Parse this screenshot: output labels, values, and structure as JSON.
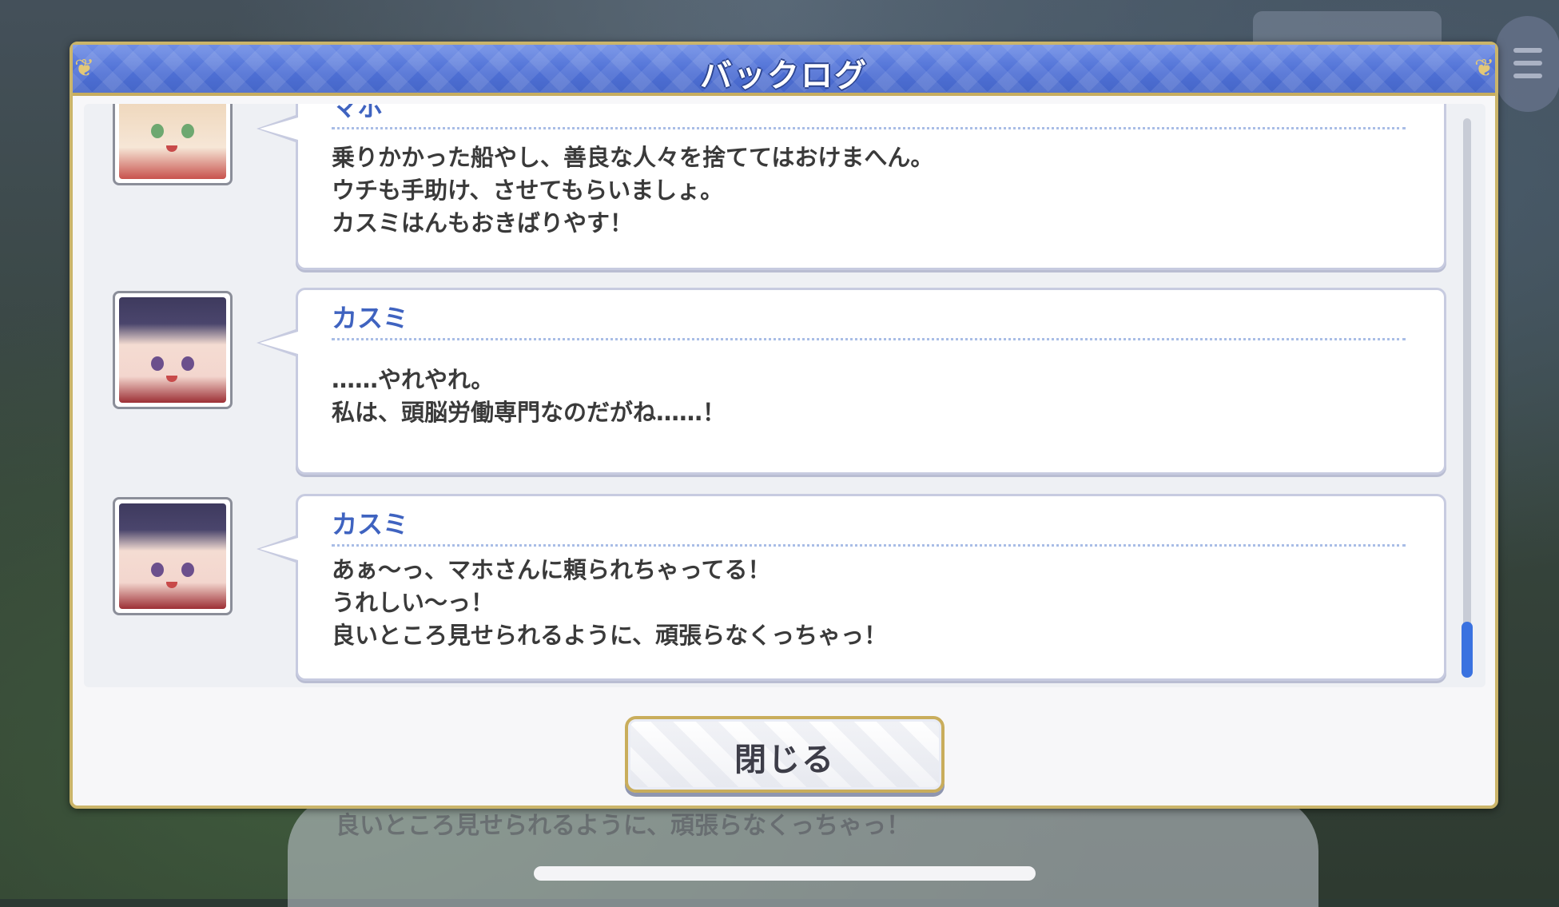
{
  "background": {
    "overlay_text": "良いところ見せられるように、頑張らなくっちゃっ！"
  },
  "dialog": {
    "title": "バックログ",
    "close_label": "閉じる"
  },
  "log": {
    "entries": [
      {
        "speaker": "マホ",
        "lines": [
          "乗りかかった船やし、善良な人々を捨ててはおけまへん。",
          "ウチも手助け、させてもらいましょ。",
          "カスミはんもおきばりやす！"
        ]
      },
      {
        "speaker": "カスミ",
        "lines": [
          "……やれやれ。",
          "私は、頭脳労働専門なのだがね……！"
        ]
      },
      {
        "speaker": "カスミ",
        "lines": [
          "あぁ〜っ、マホさんに頼られちゃってる！",
          "うれしい〜っ！",
          "良いところ見せられるように、頑張らなくっちゃっ！"
        ]
      }
    ]
  },
  "colors": {
    "accent": "#4e6fd4",
    "speaker": "#3f63c0",
    "gold_border": "#cbb56a",
    "scroll_thumb": "#3a72e0"
  }
}
